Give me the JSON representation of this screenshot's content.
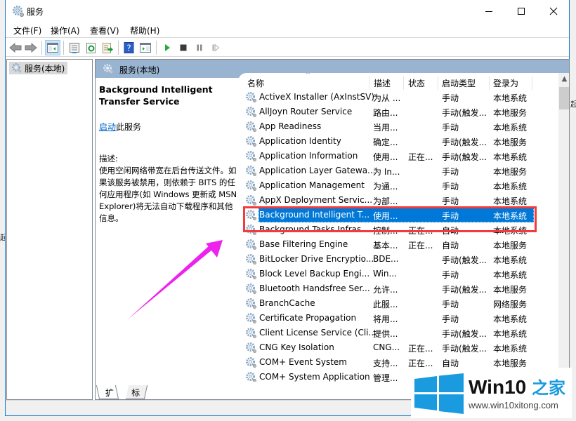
{
  "window": {
    "title": "服务",
    "minimize_label": "minimize",
    "maximize_label": "maximize",
    "close_label": "close"
  },
  "menu": [
    "文件(F)",
    "操作(A)",
    "查看(V)",
    "帮助(H)"
  ],
  "toolbar": {
    "buttons": [
      "back-icon",
      "forward-icon",
      "show-hide-console-tree-icon",
      "properties-icon",
      "refresh-icon",
      "export-list-icon",
      "help-icon",
      "show-action-pane-icon",
      "start-service-icon",
      "stop-service-icon",
      "pause-service-icon",
      "restart-service-icon"
    ]
  },
  "tree": {
    "selected_item": "服务(本地)"
  },
  "pane": {
    "header": "服务(本地)",
    "service_title": "Background Intelligent Transfer Service",
    "start_link": "启动",
    "start_suffix": "此服务",
    "description_label": "描述:",
    "description": "使用空闲网络带宽在后台传送文件。如果该服务被禁用，则依赖于 BITS 的任何应用程序(如 Windows 更新或 MSN Explorer)将无法自动下载程序和其他信息。"
  },
  "list": {
    "columns": [
      "名称",
      "描述",
      "状态",
      "启动类型",
      "登录为"
    ],
    "selected_index": 8,
    "rows": [
      {
        "name": "ActiveX Installer (AxInstSV)",
        "desc": "为从 ...",
        "status": "",
        "startup": "手动",
        "logon": "本地系统"
      },
      {
        "name": "AllJoyn Router Service",
        "desc": "路由...",
        "status": "",
        "startup": "手动(触发...",
        "logon": "本地服务"
      },
      {
        "name": "App Readiness",
        "desc": "当用...",
        "status": "",
        "startup": "手动",
        "logon": "本地系统"
      },
      {
        "name": "Application Identity",
        "desc": "确定...",
        "status": "",
        "startup": "手动(触发...",
        "logon": "本地服务"
      },
      {
        "name": "Application Information",
        "desc": "使用...",
        "status": "正在...",
        "startup": "手动(触发...",
        "logon": "本地系统"
      },
      {
        "name": "Application Layer Gatewa...",
        "desc": "为 In...",
        "status": "",
        "startup": "手动",
        "logon": "本地服务"
      },
      {
        "name": "Application Management",
        "desc": "为通...",
        "status": "",
        "startup": "手动",
        "logon": "本地系统"
      },
      {
        "name": "AppX Deployment Servic...",
        "desc": "为部...",
        "status": "",
        "startup": "手动",
        "logon": "本地系统"
      },
      {
        "name": "Background Intelligent T...",
        "desc": "使用...",
        "status": "",
        "startup": "手动",
        "logon": "本地系统"
      },
      {
        "name": "Background Tasks Infras...",
        "desc": "控制...",
        "status": "正在...",
        "startup": "自动",
        "logon": "本地系统"
      },
      {
        "name": "Base Filtering Engine",
        "desc": "基本...",
        "status": "正在...",
        "startup": "自动",
        "logon": "本地服务"
      },
      {
        "name": "BitLocker Drive Encryptio...",
        "desc": "BDE...",
        "status": "",
        "startup": "手动(触发...",
        "logon": "本地系统"
      },
      {
        "name": "Block Level Backup Engi...",
        "desc": "Win...",
        "status": "",
        "startup": "手动",
        "logon": "本地系统"
      },
      {
        "name": "Bluetooth Handsfree Ser...",
        "desc": "允许...",
        "status": "",
        "startup": "手动(触发...",
        "logon": "本地服务"
      },
      {
        "name": "BranchCache",
        "desc": "此服...",
        "status": "",
        "startup": "手动",
        "logon": "网络服务"
      },
      {
        "name": "Certificate Propagation",
        "desc": "将用...",
        "status": "",
        "startup": "手动",
        "logon": "本地系统"
      },
      {
        "name": "Client License Service (Cli...",
        "desc": "提供...",
        "status": "",
        "startup": "手动(触发...",
        "logon": "本地系统"
      },
      {
        "name": "CNG Key Isolation",
        "desc": "CNG...",
        "status": "正在...",
        "startup": "手动(触发...",
        "logon": "本地系统"
      },
      {
        "name": "COM+ Event System",
        "desc": "支持...",
        "status": "正在...",
        "startup": "自动",
        "logon": "本地服务"
      },
      {
        "name": "COM+ System Application",
        "desc": "管理...",
        "status": "",
        "startup": "",
        "logon": ""
      }
    ]
  },
  "tabs": [
    "扩展",
    "标准"
  ],
  "annotation": {
    "highlight_color": "#f23b3b",
    "arrow_color": "#ee22ee"
  },
  "watermark": {
    "brand": "Win10",
    "brand_accent": "之家",
    "url": "www.win10xitong.com",
    "color": "#1a9be0"
  }
}
